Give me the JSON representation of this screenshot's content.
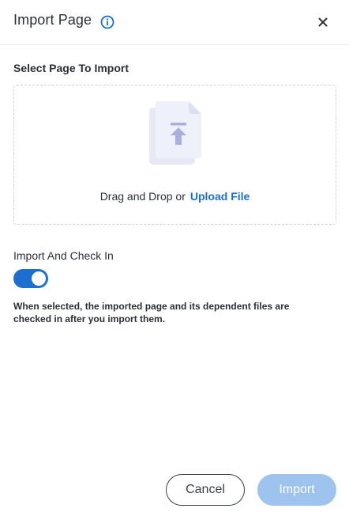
{
  "dialog": {
    "title": "Import Page",
    "info_icon": "info-icon",
    "close_icon": "close-icon"
  },
  "upload": {
    "label": "Select Page To Import",
    "illustration_icon": "file-upload-icon",
    "drop_text": "Drag and Drop or",
    "link_text": "Upload File"
  },
  "option": {
    "label": "Import And Check In",
    "checked": true,
    "help": "When selected, the imported page and its dependent files are checked in after you import them."
  },
  "actions": {
    "cancel_label": "Cancel",
    "import_label": "Import",
    "import_enabled": false
  },
  "colors": {
    "accent": "#1a6fd1",
    "disabled_button": "#9fc3ef",
    "text": "#2b2f38"
  }
}
